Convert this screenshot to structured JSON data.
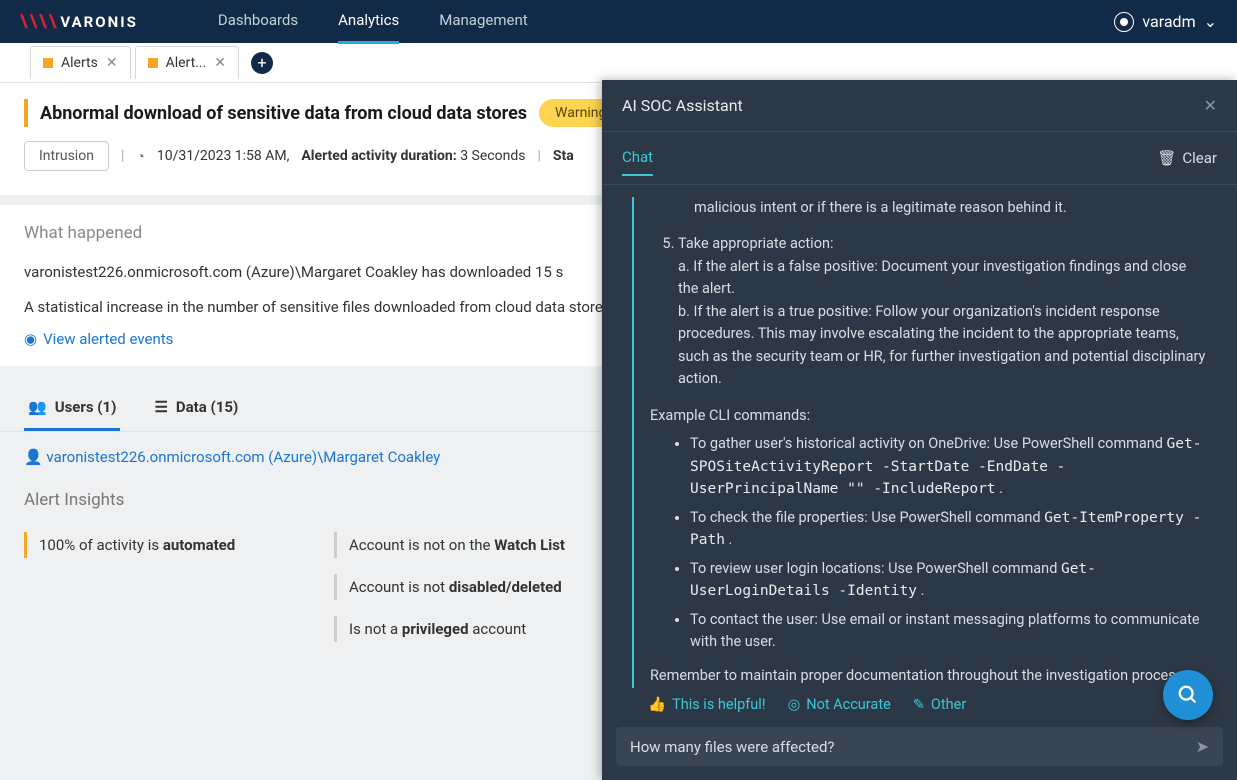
{
  "brand": "VARONIS",
  "nav": {
    "dashboards": "Dashboards",
    "analytics": "Analytics",
    "management": "Management"
  },
  "user": {
    "name": "varadm"
  },
  "tabs": [
    {
      "label": "Alerts"
    },
    {
      "label": "Alert..."
    }
  ],
  "alert": {
    "title": "Abnormal download of sensitive data from cloud data stores",
    "severity": "Warning",
    "category": "Intrusion",
    "timestamp": "10/31/2023 1:58 AM,",
    "duration_label": "Alerted activity duration:",
    "duration_value": "3 Seconds",
    "status_label": "Sta"
  },
  "what": {
    "title": "What happened",
    "line1": "varonistest226.onmicrosoft.com (Azure)\\Margaret Coakley has downloaded 15 s",
    "line2": "A statistical increase in the number of sensitive files downloaded from cloud data store activity that requires attention.",
    "link": "View alerted events"
  },
  "subtabs": {
    "users": "Users (1)",
    "data": "Data (15)"
  },
  "user_entry": "varonistest226.onmicrosoft.com (Azure)\\Margaret Coakley",
  "insights": {
    "title": "Alert Insights",
    "i1a": "100% of activity is ",
    "i1b": "automated",
    "i2a": "Account is not on the ",
    "i2b": "Watch List",
    "i3a": "Account is not ",
    "i3b": "disabled/deleted",
    "i4a": "Is not a ",
    "i4b": "privileged",
    "i4c": " account"
  },
  "assistant": {
    "title": "AI SOC Assistant",
    "tab": "Chat",
    "clear": "Clear",
    "b1": "malicious intent or if there is a legitimate reason behind it.",
    "b2": "Take appropriate action:",
    "b2a": "a. If the alert is a false positive: Document your investigation findings and close the alert.",
    "b2b": "b. If the alert is a true positive: Follow your organization's incident response procedures. This may involve escalating the incident to the appropriate teams, such as the security team or HR, for further investigation and potential disciplinary action.",
    "ex": "Example CLI commands:",
    "c1a": "To gather user's historical activity on OneDrive: Use PowerShell command ",
    "c1b": "Get-SPOSiteActivityReport -StartDate -EndDate -UserPrincipalName \"\" -IncludeReport",
    "c2a": "To check the file properties: Use PowerShell command ",
    "c2b": "Get-ItemProperty -Path",
    "c3a": "To review user login locations: Use PowerShell command ",
    "c3b": "Get-UserLoginDetails -Identity",
    "c4": "To contact the user: Use email or instant messaging platforms to communicate with the user.",
    "rem": "Remember to maintain proper documentation throughout the investigation process.",
    "fb1": "This is helpful!",
    "fb2": "Not Accurate",
    "fb3": "Other",
    "input": "How many files were affected?"
  }
}
